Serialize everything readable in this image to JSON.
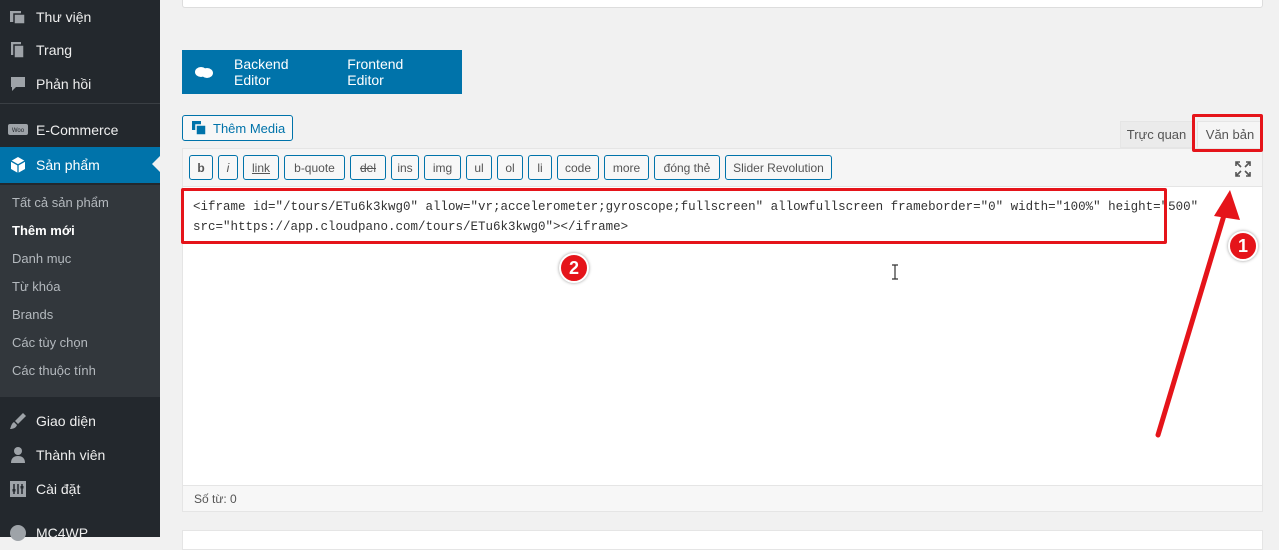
{
  "sidebar": {
    "top_items": [
      {
        "label": "Thư viện",
        "icon": "media-library-icon"
      },
      {
        "label": "Trang",
        "icon": "page-icon"
      },
      {
        "label": "Phản hồi",
        "icon": "comment-icon"
      }
    ],
    "ecommerce": {
      "label": "E-Commerce",
      "icon": "woo-icon"
    },
    "products": {
      "label": "Sản phẩm",
      "icon": "cube-icon"
    },
    "submenu": [
      "Tất cả sản phẩm",
      "Thêm mới",
      "Danh mục",
      "Từ khóa",
      "Brands",
      "Các tùy chọn",
      "Các thuộc tính"
    ],
    "bottom_items": [
      {
        "label": "Giao diện",
        "icon": "brush-icon"
      },
      {
        "label": "Thành viên",
        "icon": "user-icon"
      },
      {
        "label": "Cài đặt",
        "icon": "settings-icon"
      },
      {
        "label": "MC4WP",
        "icon": "mc4wp-icon"
      }
    ]
  },
  "builder": {
    "backend": "Backend Editor",
    "frontend": "Frontend Editor"
  },
  "add_media": "Thêm Media",
  "tabs": {
    "visual": "Trực quan",
    "text": "Văn bản"
  },
  "quicktags": [
    "b",
    "i",
    "link",
    "b-quote",
    "del",
    "ins",
    "img",
    "ul",
    "ol",
    "li",
    "code",
    "more",
    "đóng thẻ",
    "Slider Revolution"
  ],
  "content": {
    "line1": "<iframe id=\"/tours/ETu6k3kwg0\" allow=\"vr;accelerometer;gyroscope;fullscreen\" allowfullscreen frameborder=\"0\" width=\"100%\" height=\"500\"",
    "line2": "src=\"https://app.cloudpano.com/tours/ETu6k3kwg0\"></iframe>"
  },
  "word_count": "Số từ: 0",
  "annotations": {
    "badge1": "1",
    "badge2": "2"
  },
  "colors": {
    "accent": "#0073aa",
    "annotation": "#e5141a",
    "sidebar": "#23282d"
  }
}
